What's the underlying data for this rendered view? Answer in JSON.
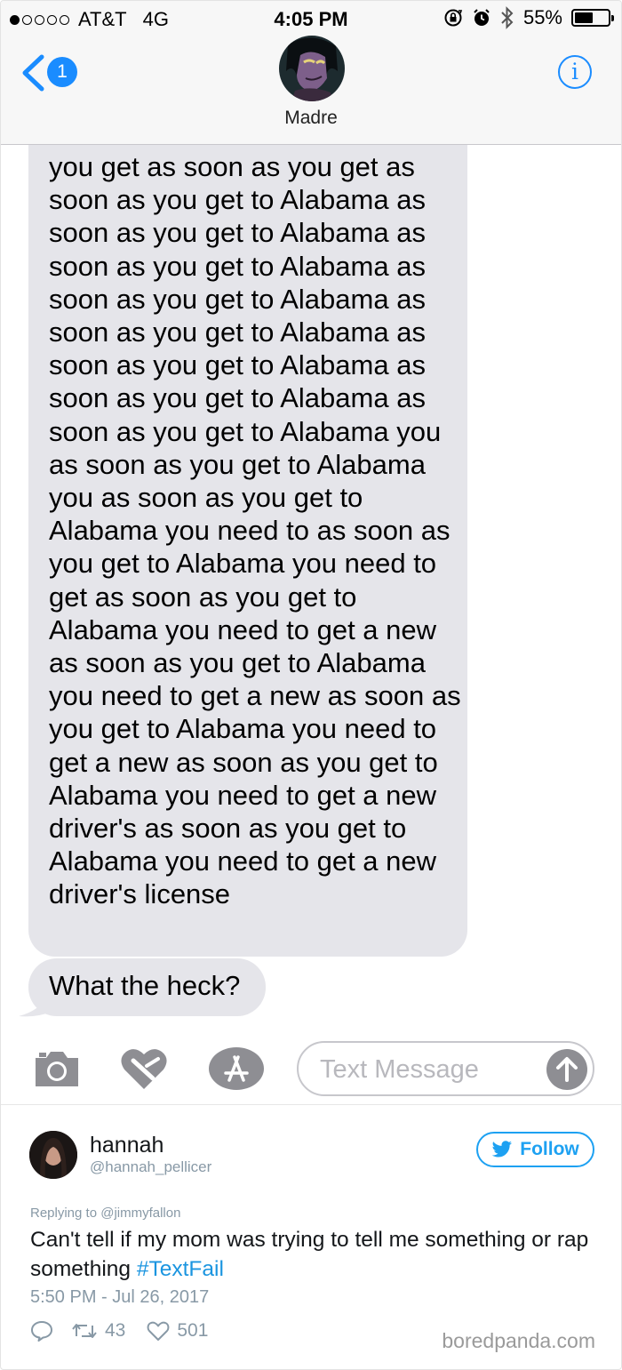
{
  "status_bar": {
    "carrier": "AT&T",
    "network": "4G",
    "time": "4:05 PM",
    "battery": "55%",
    "battery_level": 0.55,
    "signal_dots": 1
  },
  "header": {
    "back_badge": "1",
    "contact_name": "Madre",
    "info_glyph": "i"
  },
  "messages": [
    "you get as soon as you get as soon as you get to Alabama as soon as you get to Alabama as soon as you get to Alabama as soon as you get to Alabama as soon as you get to Alabama as soon as you get to Alabama as soon as you get to Alabama as soon as you get to Alabama you as soon as you get to Alabama you as soon as you get to Alabama you need to as soon as you get to Alabama you need to get as soon as you get to Alabama you need to get a new as soon as you get to Alabama you need to get a new as soon as you get to Alabama you need to get a new as soon as you get to Alabama you need to get a new driver's as soon as you get to Alabama you need to get a new driver's license",
    "What the heck?"
  ],
  "input_bar": {
    "placeholder": "Text Message",
    "icons": [
      "camera-icon",
      "digital-touch-icon",
      "app-store-icon",
      "send-arrow-icon"
    ]
  },
  "tweet": {
    "name": "hannah",
    "handle": "@hannah_pellicer",
    "follow_label": "Follow",
    "replying_to": "Replying to @jimmyfallon",
    "text_before": "Can't tell if my mom was trying to tell me something or rap something ",
    "hashtag": "#TextFail",
    "timestamp": "5:50 PM - Jul 26, 2017",
    "retweets": "43",
    "likes": "501"
  },
  "watermark": "boredpanda.com",
  "colors": {
    "ios_blue": "#1a8cff",
    "bubble_gray": "#e5e5ea",
    "twitter_blue": "#1da1f2",
    "muted": "#8899a6"
  }
}
